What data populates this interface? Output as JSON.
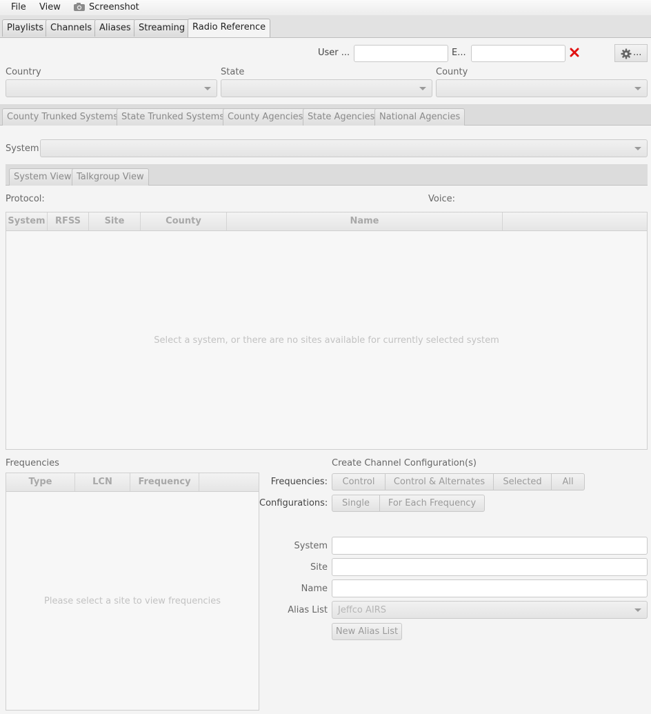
{
  "menu": {
    "file": "File",
    "view": "View",
    "screenshot": "Screenshot"
  },
  "main_tabs": [
    "Playlists",
    "Channels",
    "Aliases",
    "Streaming",
    "Radio Reference"
  ],
  "login": {
    "user_label": "User ...",
    "user_value": "",
    "password_label": "E...",
    "password_value": "",
    "settings_label": "..."
  },
  "location": {
    "country_label": "Country",
    "country_value": "",
    "state_label": "State",
    "state_value": "",
    "county_label": "County",
    "county_value": ""
  },
  "system_tabs": [
    "County Trunked Systems",
    "State Trunked Systems",
    "County Agencies",
    "State Agencies",
    "National Agencies"
  ],
  "system": {
    "label": "System",
    "value": ""
  },
  "view_tabs": [
    "System View",
    "Talkgroup View"
  ],
  "info": {
    "protocol_label": "Protocol:",
    "voice_label": "Voice:"
  },
  "sites_table": {
    "columns": [
      "System",
      "RFSS",
      "Site",
      "County",
      "Name"
    ],
    "placeholder": "Select a system, or there are no sites available for currently selected system"
  },
  "frequencies": {
    "title": "Frequencies",
    "columns": [
      "Type",
      "LCN",
      "Frequency"
    ],
    "placeholder": "Please select a site to view frequencies"
  },
  "create": {
    "title": "Create Channel Configuration(s)",
    "frequencies_label": "Frequencies:",
    "frequency_buttons": [
      "Control",
      "Control & Alternates",
      "Selected",
      "All"
    ],
    "configurations_label": "Configurations:",
    "configuration_buttons": [
      "Single",
      "For Each Frequency"
    ],
    "system_label": "System",
    "system_value": "",
    "site_label": "Site",
    "site_value": "",
    "name_label": "Name",
    "name_value": "",
    "alias_list_label": "Alias List",
    "alias_list_value": "Jeffco AIRS",
    "new_alias_list": "New Alias List"
  },
  "colors": {
    "clear_icon": "#e01010",
    "background": "#f4f4f4"
  }
}
